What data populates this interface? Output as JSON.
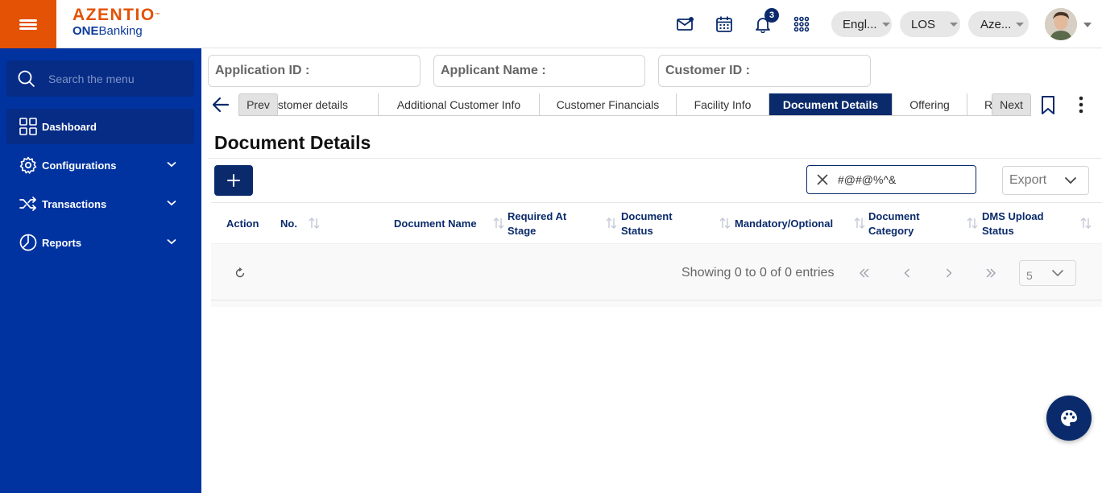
{
  "header": {
    "brand": "AZENTIO",
    "product_bold": "ONE",
    "product_rest": "Banking",
    "notification_count": "3",
    "language": "Engl...",
    "module": "LOS",
    "entity": "Aze..."
  },
  "sidebar": {
    "search_placeholder": "Search the menu",
    "items": [
      {
        "label": "Dashboard",
        "icon": "grid-icon"
      },
      {
        "label": "Configurations",
        "icon": "gear-icon"
      },
      {
        "label": "Transactions",
        "icon": "shuffle-icon"
      },
      {
        "label": "Reports",
        "icon": "pie-chart-icon"
      }
    ]
  },
  "fields": {
    "application_id": "Application ID :",
    "applicant_name": "Applicant Name :",
    "customer_id": "Customer ID :"
  },
  "tabs": {
    "prev": "Prev",
    "next": "Next",
    "items": [
      "Customer details",
      "Additional Customer Info",
      "Customer Financials",
      "Facility Info",
      "Document Details",
      "Offering",
      "R"
    ],
    "active": "Document Details"
  },
  "page": {
    "title": "Document Details"
  },
  "toolbar": {
    "search_value": "#@#@%^&",
    "export_label": "Export"
  },
  "table": {
    "columns": [
      {
        "line1": "Action",
        "line2": ""
      },
      {
        "line1": "No.",
        "line2": ""
      },
      {
        "line1": "Document Name",
        "line2": ""
      },
      {
        "line1": "Required At",
        "line2": "Stage"
      },
      {
        "line1": "Document",
        "line2": "Status"
      },
      {
        "line1": "Mandatory/Optional",
        "line2": ""
      },
      {
        "line1": "Document",
        "line2": "Category"
      },
      {
        "line1": "DMS Upload",
        "line2": "Status"
      }
    ],
    "rows": [],
    "showing_text": "Showing 0 to 0 of 0 entries",
    "page_size": "5"
  },
  "colors": {
    "brand_orange": "#e35205",
    "sidebar_blue": "#0033a0",
    "navy": "#0a2a6b"
  }
}
